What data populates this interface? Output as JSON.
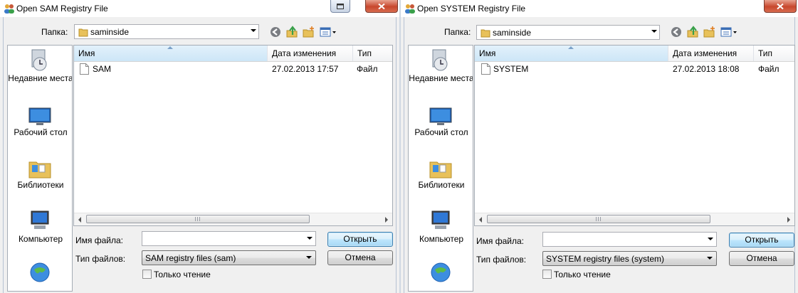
{
  "dialogs": [
    {
      "title": "Open SAM Registry File",
      "look_in_label": "Папка:",
      "look_in_value": "saminside",
      "places": [
        "Недавние места",
        "Рабочий стол",
        "Библиотеки",
        "Компьютер",
        ""
      ],
      "columns": {
        "name": "Имя",
        "date": "Дата изменения",
        "type": "Тип"
      },
      "files": [
        {
          "name": "SAM",
          "date": "27.02.2013 17:57",
          "type": "Файл"
        }
      ],
      "filename_label": "Имя файла:",
      "filename_value": "",
      "filetype_label": "Тип файлов:",
      "filetype_value": "SAM registry files (sam)",
      "readonly_label": "Только чтение",
      "open_label": "Открыть",
      "cancel_label": "Отмена"
    },
    {
      "title": "Open SYSTEM Registry File",
      "look_in_label": "Папка:",
      "look_in_value": "saminside",
      "places": [
        "Недавние места",
        "Рабочий стол",
        "Библиотеки",
        "Компьютер",
        ""
      ],
      "columns": {
        "name": "Имя",
        "date": "Дата изменения",
        "type": "Тип"
      },
      "files": [
        {
          "name": "SYSTEM",
          "date": "27.02.2013 18:08",
          "type": "Файл"
        }
      ],
      "filename_label": "Имя файла:",
      "filename_value": "",
      "filetype_label": "Тип файлов:",
      "filetype_value": "SYSTEM registry files (system)",
      "readonly_label": "Только чтение",
      "open_label": "Открыть",
      "cancel_label": "Отмена"
    }
  ],
  "icons": {
    "app": "users-icon",
    "back": "back-arrow-icon",
    "up": "up-folder-icon",
    "new_folder": "new-folder-icon",
    "views": "views-menu-icon",
    "recent": "recent-places-icon",
    "desktop": "desktop-icon",
    "libraries": "libraries-icon",
    "computer": "computer-icon",
    "network": "network-icon",
    "file": "file-icon"
  },
  "colors": {
    "dialog_bg": "#f0f0f0",
    "sorted_header": "#cde6f7",
    "default_button_border": "#3c7fb1",
    "close_button": "#c7472d"
  }
}
